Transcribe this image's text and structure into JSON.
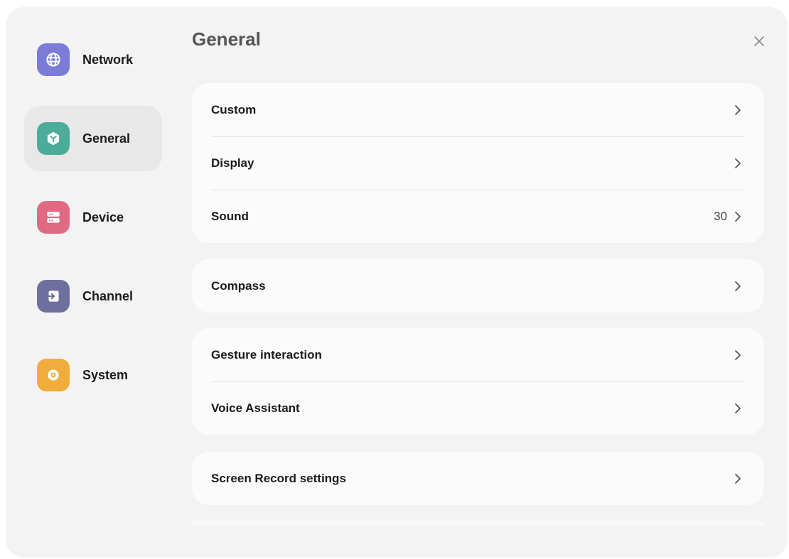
{
  "header": {
    "title": "General"
  },
  "colors": {
    "network": "#7b7bd8",
    "general": "#4dab9a",
    "device": "#e06a82",
    "channel": "#6f6f9e",
    "system": "#f1ad3b"
  },
  "sidebar": {
    "items": [
      {
        "label": "Network",
        "icon": "globe-icon",
        "active": false
      },
      {
        "label": "General",
        "icon": "cube-icon",
        "active": true
      },
      {
        "label": "Device",
        "icon": "server-icon",
        "active": false
      },
      {
        "label": "Channel",
        "icon": "input-arrow-icon",
        "active": false
      },
      {
        "label": "System",
        "icon": "gear-icon",
        "active": false
      }
    ]
  },
  "groups": [
    {
      "rows": [
        {
          "label": "Custom"
        },
        {
          "label": "Display"
        },
        {
          "label": "Sound",
          "value": "30"
        }
      ]
    },
    {
      "rows": [
        {
          "label": "Compass"
        }
      ]
    },
    {
      "rows": [
        {
          "label": "Gesture interaction"
        },
        {
          "label": "Voice Assistant"
        }
      ]
    },
    {
      "rows": [
        {
          "label": "Screen Record settings"
        }
      ]
    }
  ]
}
